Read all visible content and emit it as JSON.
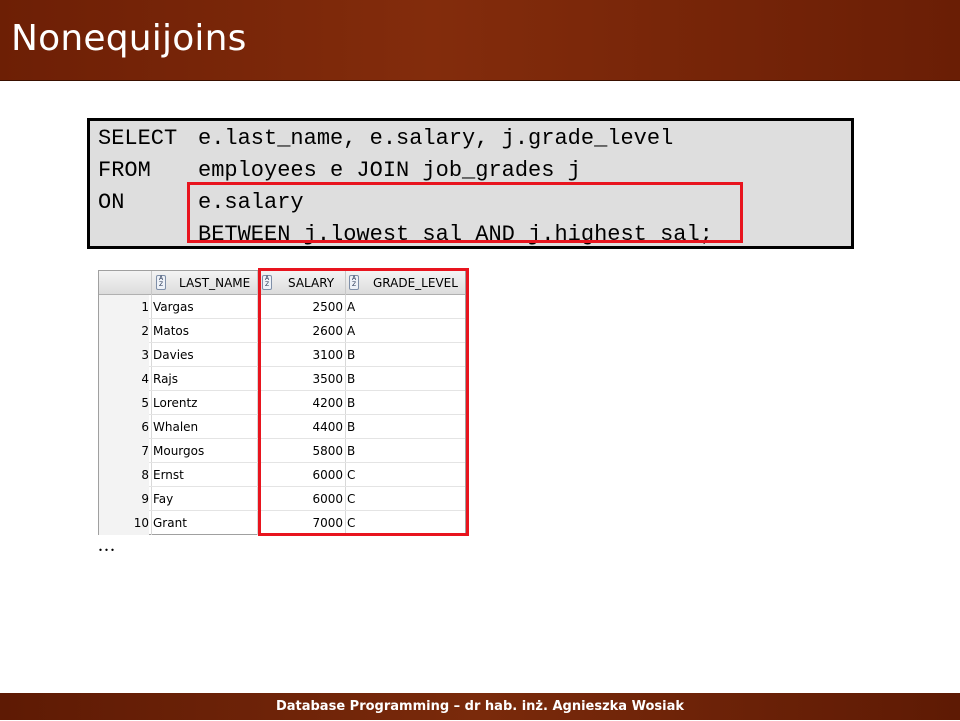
{
  "slide": {
    "title": "Nonequijoins",
    "footer": "Database Programming – dr hab. inż. Agnieszka Wosiak"
  },
  "code": {
    "lines": [
      {
        "kw": "SELECT",
        "rest": "e.last_name, e.salary, j.grade_level"
      },
      {
        "kw": "FROM",
        "rest": "employees e JOIN job_grades j"
      },
      {
        "kw": "ON",
        "rest": "e.salary"
      },
      {
        "kw": "",
        "rest": "BETWEEN j.lowest_sal AND j.highest_sal;"
      }
    ]
  },
  "result_grid": {
    "columns": [
      "LAST_NAME",
      "SALARY",
      "GRADE_LEVEL"
    ],
    "rows": [
      {
        "n": "1",
        "last_name": "Vargas",
        "salary": "2500",
        "grade": "A"
      },
      {
        "n": "2",
        "last_name": "Matos",
        "salary": "2600",
        "grade": "A"
      },
      {
        "n": "3",
        "last_name": "Davies",
        "salary": "3100",
        "grade": "B"
      },
      {
        "n": "4",
        "last_name": "Rajs",
        "salary": "3500",
        "grade": "B"
      },
      {
        "n": "5",
        "last_name": "Lorentz",
        "salary": "4200",
        "grade": "B"
      },
      {
        "n": "6",
        "last_name": "Whalen",
        "salary": "4400",
        "grade": "B"
      },
      {
        "n": "7",
        "last_name": "Mourgos",
        "salary": "5800",
        "grade": "B"
      },
      {
        "n": "8",
        "last_name": "Ernst",
        "salary": "6000",
        "grade": "C"
      },
      {
        "n": "9",
        "last_name": "Fay",
        "salary": "6000",
        "grade": "C"
      },
      {
        "n": "10",
        "last_name": "Grant",
        "salary": "7000",
        "grade": "C"
      }
    ],
    "continuation": "..."
  },
  "colors": {
    "title_bg": "#7a2a0b",
    "highlight": "#e8141e",
    "code_bg": "#dedede"
  }
}
